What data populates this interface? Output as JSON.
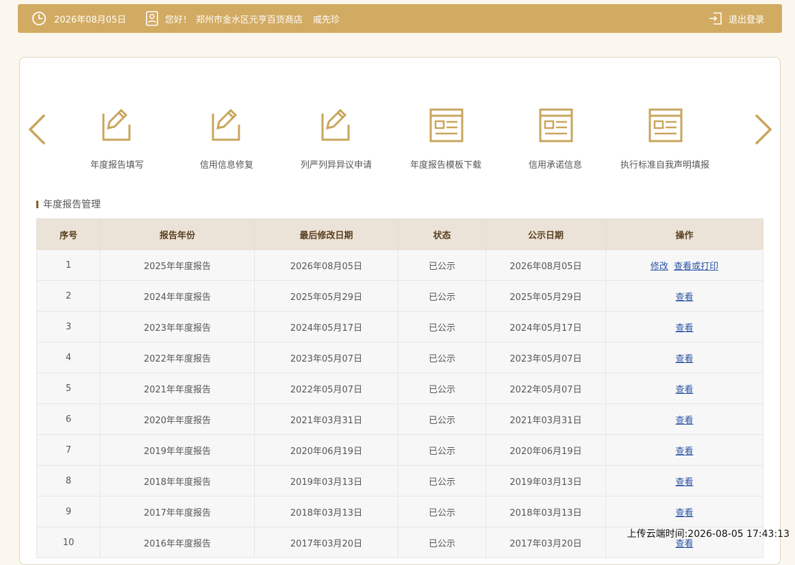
{
  "header": {
    "date": "2026年08月05日",
    "greeting": "您好！",
    "company": "郑州市金水区元亨百货商店",
    "user": "戚先珍",
    "logout_label": "退出登录"
  },
  "nav": {
    "items": [
      {
        "label": "年度报告填写",
        "icon": "edit-icon"
      },
      {
        "label": "信用信息修复",
        "icon": "edit-icon"
      },
      {
        "label": "列严列异异议申请",
        "icon": "edit-icon"
      },
      {
        "label": "年度报告模板下载",
        "icon": "document-window-icon"
      },
      {
        "label": "信用承诺信息",
        "icon": "document-window-icon"
      },
      {
        "label": "执行标准自我声明填报",
        "icon": "document-window-icon"
      }
    ]
  },
  "section": {
    "title": "年度报告管理"
  },
  "table": {
    "headers": [
      "序号",
      "报告年份",
      "最后修改日期",
      "状态",
      "公示日期",
      "操作"
    ],
    "rows": [
      {
        "no": "1",
        "year": "2025年年度报告",
        "modified": "2026年08月05日",
        "status": "已公示",
        "published": "2026年08月05日",
        "actions": [
          "修改",
          "查看或打印"
        ]
      },
      {
        "no": "2",
        "year": "2024年年度报告",
        "modified": "2025年05月29日",
        "status": "已公示",
        "published": "2025年05月29日",
        "actions": [
          "查看"
        ]
      },
      {
        "no": "3",
        "year": "2023年年度报告",
        "modified": "2024年05月17日",
        "status": "已公示",
        "published": "2024年05月17日",
        "actions": [
          "查看"
        ]
      },
      {
        "no": "4",
        "year": "2022年年度报告",
        "modified": "2023年05月07日",
        "status": "已公示",
        "published": "2023年05月07日",
        "actions": [
          "查看"
        ]
      },
      {
        "no": "5",
        "year": "2021年年度报告",
        "modified": "2022年05月07日",
        "status": "已公示",
        "published": "2022年05月07日",
        "actions": [
          "查看"
        ]
      },
      {
        "no": "6",
        "year": "2020年年度报告",
        "modified": "2021年03月31日",
        "status": "已公示",
        "published": "2021年03月31日",
        "actions": [
          "查看"
        ]
      },
      {
        "no": "7",
        "year": "2019年年度报告",
        "modified": "2020年06月19日",
        "status": "已公示",
        "published": "2020年06月19日",
        "actions": [
          "查看"
        ]
      },
      {
        "no": "8",
        "year": "2018年年度报告",
        "modified": "2019年03月13日",
        "status": "已公示",
        "published": "2019年03月13日",
        "actions": [
          "查看"
        ]
      },
      {
        "no": "9",
        "year": "2017年年度报告",
        "modified": "2018年03月13日",
        "status": "已公示",
        "published": "2018年03月13日",
        "actions": [
          "查看"
        ]
      },
      {
        "no": "10",
        "year": "2016年年度报告",
        "modified": "2017年03月20日",
        "status": "已公示",
        "published": "2017年03月20日",
        "actions": [
          "查看"
        ]
      }
    ]
  },
  "footer": {
    "upload_time": "上传云端时间:2026-08-05 17:43:13"
  },
  "colors": {
    "accent": "#d2ab62",
    "icon_gold": "#c9a55c",
    "link": "#2b53a6"
  }
}
